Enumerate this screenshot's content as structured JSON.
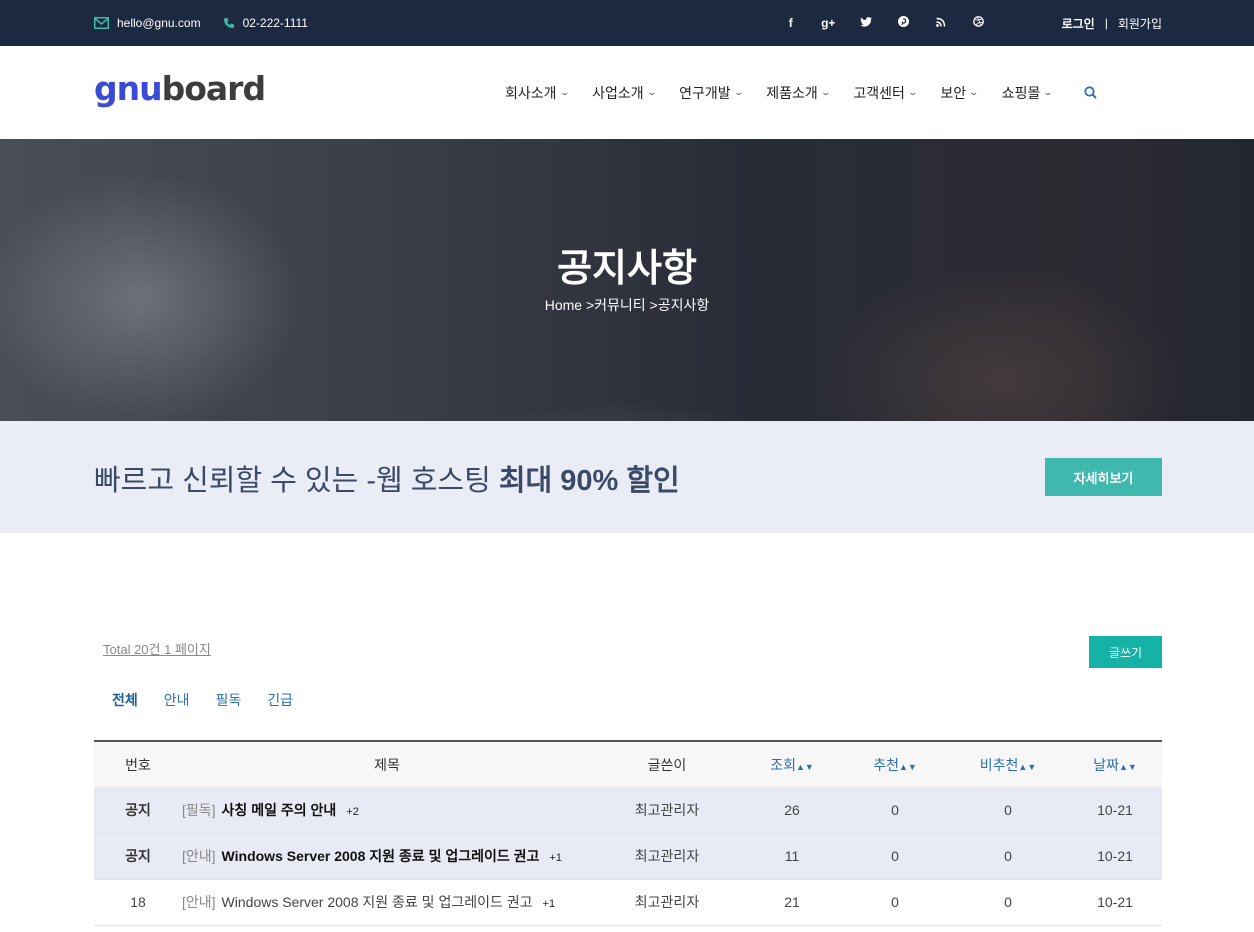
{
  "topbar": {
    "email": "hello@gnu.com",
    "phone": "02-222-1111",
    "social": [
      "f",
      "g+",
      "t",
      "p",
      "rss",
      "d"
    ],
    "login": "로그인",
    "sep": "|",
    "join": "회원가입"
  },
  "header": {
    "logo_part1": "gnu",
    "logo_part2": "board",
    "nav": [
      "회사소개",
      "사업소개",
      "연구개발",
      "제품소개",
      "고객센터",
      "보안",
      "쇼핑몰"
    ]
  },
  "hero": {
    "title": "공지사항",
    "breadcrumb": "Home >커뮤니티 >공지사항"
  },
  "promo": {
    "text": "빠르고 신뢰할 수 있는 -웹 호스팅",
    "highlight": "최대 90% 할인",
    "button": "자세히보기"
  },
  "board": {
    "total": "Total 20건 1 페이지",
    "write_button": "글쓰기",
    "categories": [
      "전체",
      "안내",
      "필독",
      "긴급"
    ],
    "columns": [
      "번호",
      "제목",
      "글쓴이",
      "조회",
      "추천",
      "비추천",
      "날짜"
    ],
    "rows": [
      {
        "num": "공지",
        "tag": "[필독]",
        "title": "사칭 메일 주의 안내",
        "comments": "+2",
        "author": "최고관리자",
        "views": "26",
        "up": "0",
        "down": "0",
        "date": "10-21"
      },
      {
        "num": "공지",
        "tag": "[안내]",
        "title": "Windows Server 2008 지원 종료 및 업그레이드 권고",
        "comments": "+1",
        "author": "최고관리자",
        "views": "11",
        "up": "0",
        "down": "0",
        "date": "10-21"
      },
      {
        "num": "18",
        "tag": "[안내]",
        "title": "Windows Server 2008 지원 종료 및 업그레이드 권고",
        "comments": "+1",
        "author": "최고관리자",
        "views": "21",
        "up": "0",
        "down": "0",
        "date": "10-21"
      }
    ]
  }
}
